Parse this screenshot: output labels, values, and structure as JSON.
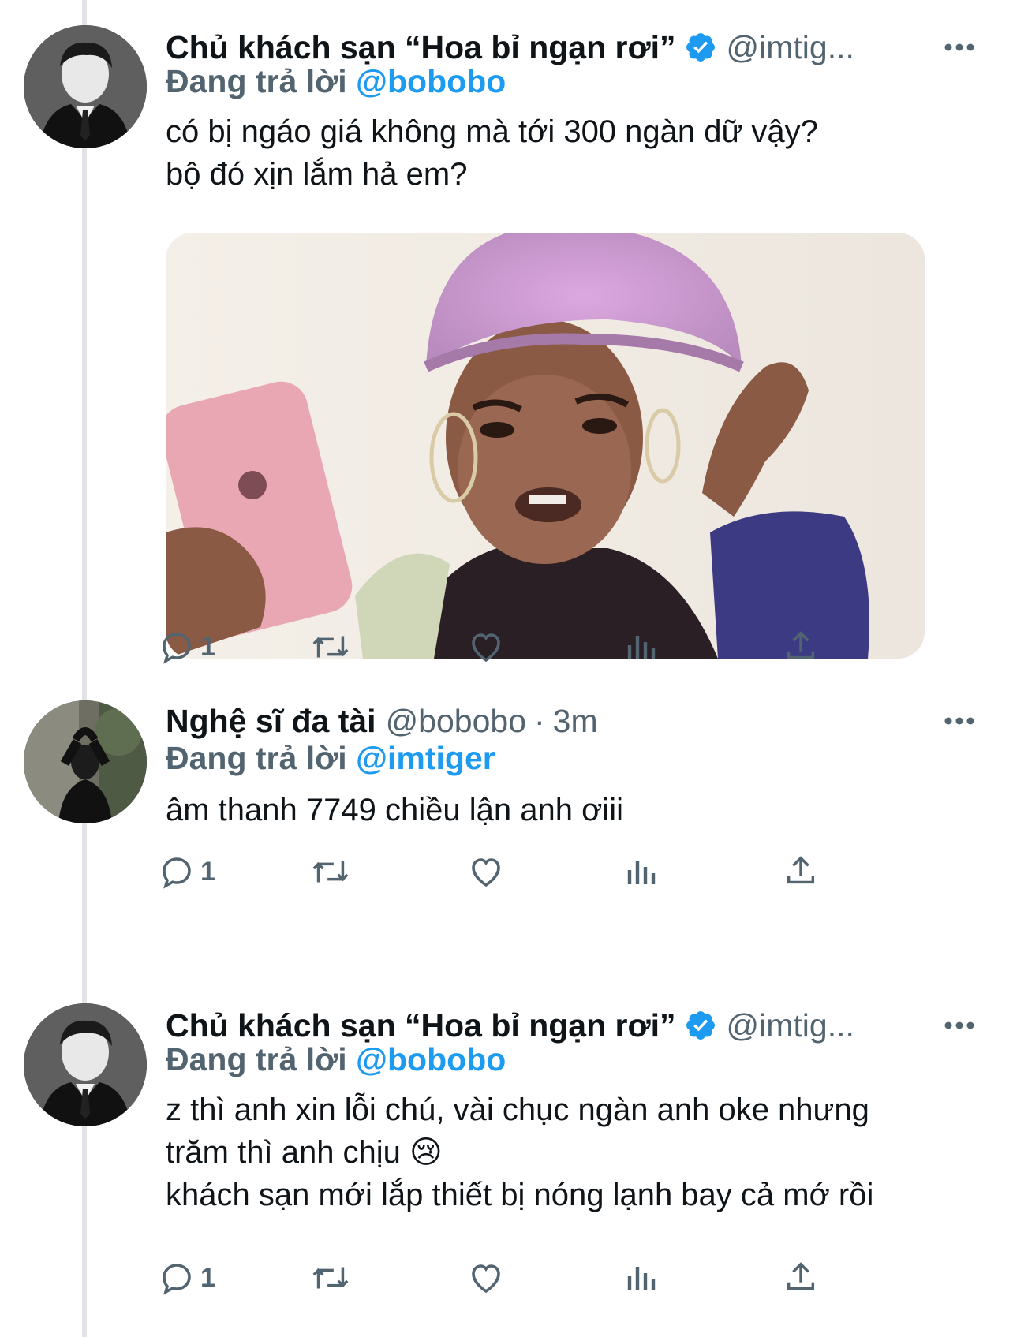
{
  "tweets": [
    {
      "display_name": "Chủ khách sạn “Hoa bỉ ngạn rơi”",
      "verified": true,
      "handle": "@imtig...",
      "time": "",
      "reply_label": "Đang trả lời",
      "reply_to": "@bobobo",
      "text_lines": [
        "có bị ngáo giá không mà tới 300 ngàn dữ vậy?",
        "bộ đó xịn lắm hả em?"
      ],
      "has_media": true,
      "reply_count": "1"
    },
    {
      "display_name": "Nghệ sĩ đa tài",
      "verified": false,
      "handle": "@bobobo",
      "separator": "·",
      "time": "3m",
      "reply_label": "Đang trả lời",
      "reply_to": "@imtiger",
      "text_lines": [
        "âm thanh 7749 chiều lận anh ơiii"
      ],
      "has_media": false,
      "reply_count": "1"
    },
    {
      "display_name": "Chủ khách sạn “Hoa bỉ ngạn rơi”",
      "verified": true,
      "handle": "@imtig...",
      "time": "",
      "reply_label": "Đang trả lời",
      "reply_to": "@bobobo",
      "text_lines": [
        "z thì anh xin lỗi chú, vài chục ngàn anh oke nhưng",
        "trăm thì anh chịu 😢",
        "khách sạn mới lắp thiết bị nóng lạnh bay cả mớ rồi"
      ],
      "has_media": false,
      "reply_count": "1"
    }
  ],
  "icons": {
    "reply": "reply-icon",
    "retweet": "retweet-icon",
    "like": "heart-icon",
    "views": "analytics-icon",
    "share": "share-icon",
    "more": "more-icon",
    "verified": "verified-badge-icon"
  },
  "colors": {
    "text": "#0f1419",
    "secondary": "#536471",
    "accent": "#1d9bf0",
    "thread_line": "#e1e3e6"
  }
}
